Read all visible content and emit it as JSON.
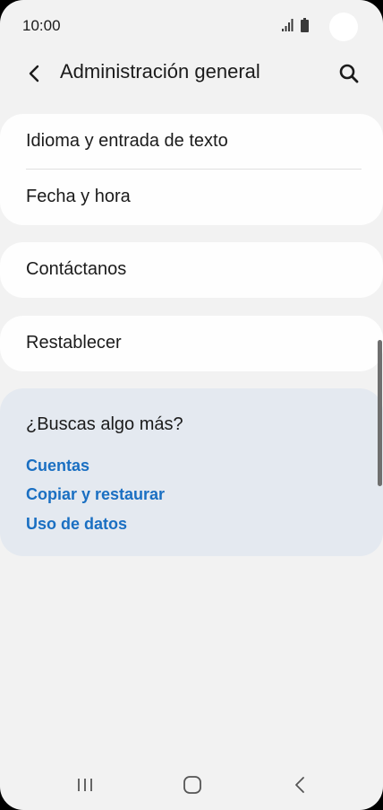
{
  "status_bar": {
    "time": "10:00",
    "icons": [
      "signal-icon",
      "battery-icon",
      "camera-cutout"
    ]
  },
  "app_bar": {
    "title": "Administración general",
    "back_icon": "back-arrow-icon",
    "search_icon": "search-icon"
  },
  "settings_group_1": {
    "items": [
      {
        "label": "Idioma y entrada de texto"
      },
      {
        "label": "Fecha y hora"
      }
    ]
  },
  "settings_group_2": {
    "items": [
      {
        "label": "Contáctanos"
      }
    ]
  },
  "settings_group_3": {
    "items": [
      {
        "label": "Restablecer"
      }
    ]
  },
  "suggestions": {
    "title": "¿Buscas algo más?",
    "links": [
      {
        "label": "Cuentas"
      },
      {
        "label": "Copiar y restaurar"
      },
      {
        "label": "Uso de datos"
      }
    ]
  },
  "nav_bar": {
    "icons": [
      "recent-apps-icon",
      "home-icon",
      "back-icon"
    ]
  },
  "colors": {
    "background": "#f2f2f2",
    "card": "#fefefe",
    "suggestion_card": "#e4e9f0",
    "link": "#1a6fc2",
    "text": "#1b1b1b"
  }
}
